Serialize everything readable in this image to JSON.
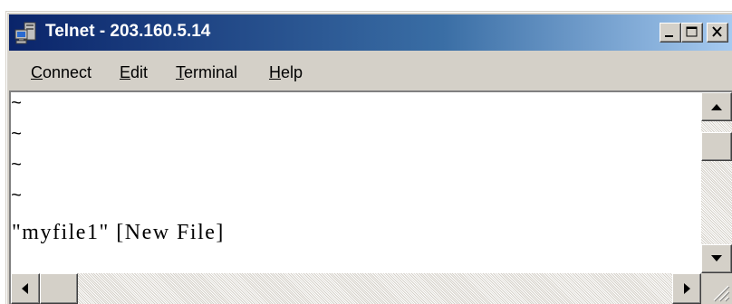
{
  "window": {
    "title": "Telnet - 203.160.5.14",
    "icon": "telnet-computer-icon"
  },
  "menubar": {
    "connect": {
      "first": "C",
      "rest": "onnect"
    },
    "edit": {
      "first": "E",
      "rest": "dit"
    },
    "terminal": {
      "first": "T",
      "rest": "erminal"
    },
    "help": {
      "first": "H",
      "rest": "elp"
    }
  },
  "terminal": {
    "lines": [
      "~",
      "~",
      "~",
      "~"
    ],
    "status": "\"myfile1\" [New File]"
  },
  "colors": {
    "titlebar_start": "#0a246a",
    "titlebar_end": "#a6caf0",
    "chrome": "#d4d0c8"
  }
}
